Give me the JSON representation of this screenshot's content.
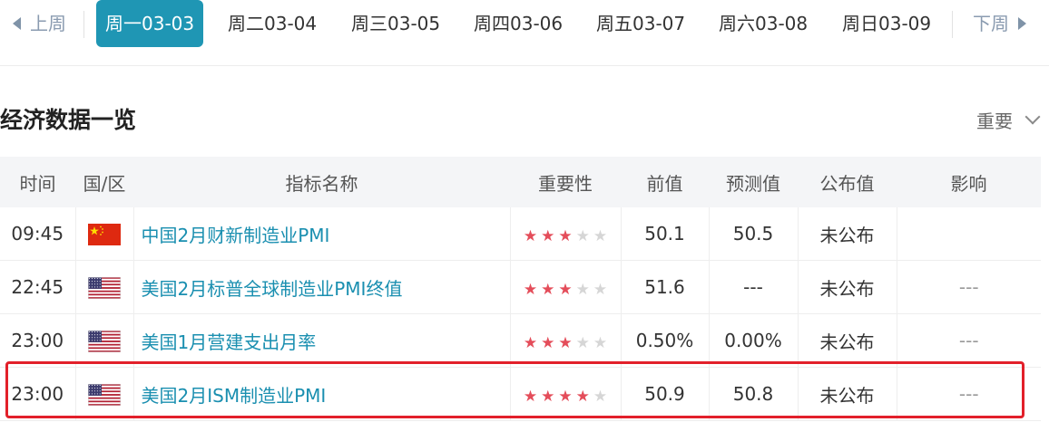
{
  "week_nav": {
    "prev_label": "上周",
    "next_label": "下周",
    "days": [
      "周一03-03",
      "周二03-04",
      "周三03-05",
      "周四03-06",
      "周五03-07",
      "周六03-08",
      "周日03-09"
    ],
    "active_index": 0
  },
  "section": {
    "title": "经济数据一览",
    "filter_label": "重要"
  },
  "table": {
    "headers": [
      "时间",
      "国/区",
      "指标名称",
      "重要性",
      "前值",
      "预测值",
      "公布值",
      "影响"
    ],
    "rows": [
      {
        "time": "09:45",
        "country": "china-flag-icon",
        "name": "中国2月财新制造业PMI",
        "stars": 3,
        "prev": "50.1",
        "forecast": "50.5",
        "actual": "未公布",
        "impact": ""
      },
      {
        "time": "22:45",
        "country": "usa-flag-icon",
        "name": "美国2月标普全球制造业PMI终值",
        "stars": 3,
        "prev": "51.6",
        "forecast": "---",
        "actual": "未公布",
        "impact": "---"
      },
      {
        "time": "23:00",
        "country": "usa-flag-icon",
        "name": "美国1月营建支出月率",
        "stars": 3,
        "prev": "0.50%",
        "forecast": "0.00%",
        "actual": "未公布",
        "impact": "---"
      },
      {
        "time": "23:00",
        "country": "usa-flag-icon",
        "name": "美国2月ISM制造业PMI",
        "stars": 4,
        "prev": "50.9",
        "forecast": "50.8",
        "actual": "未公布",
        "impact": "---"
      }
    ]
  },
  "colors": {
    "accent": "#1f96b4",
    "star_on": "#e44d5a",
    "star_off": "#d6d6d6",
    "highlight": "#e2202a",
    "link": "#1a8fb0"
  }
}
